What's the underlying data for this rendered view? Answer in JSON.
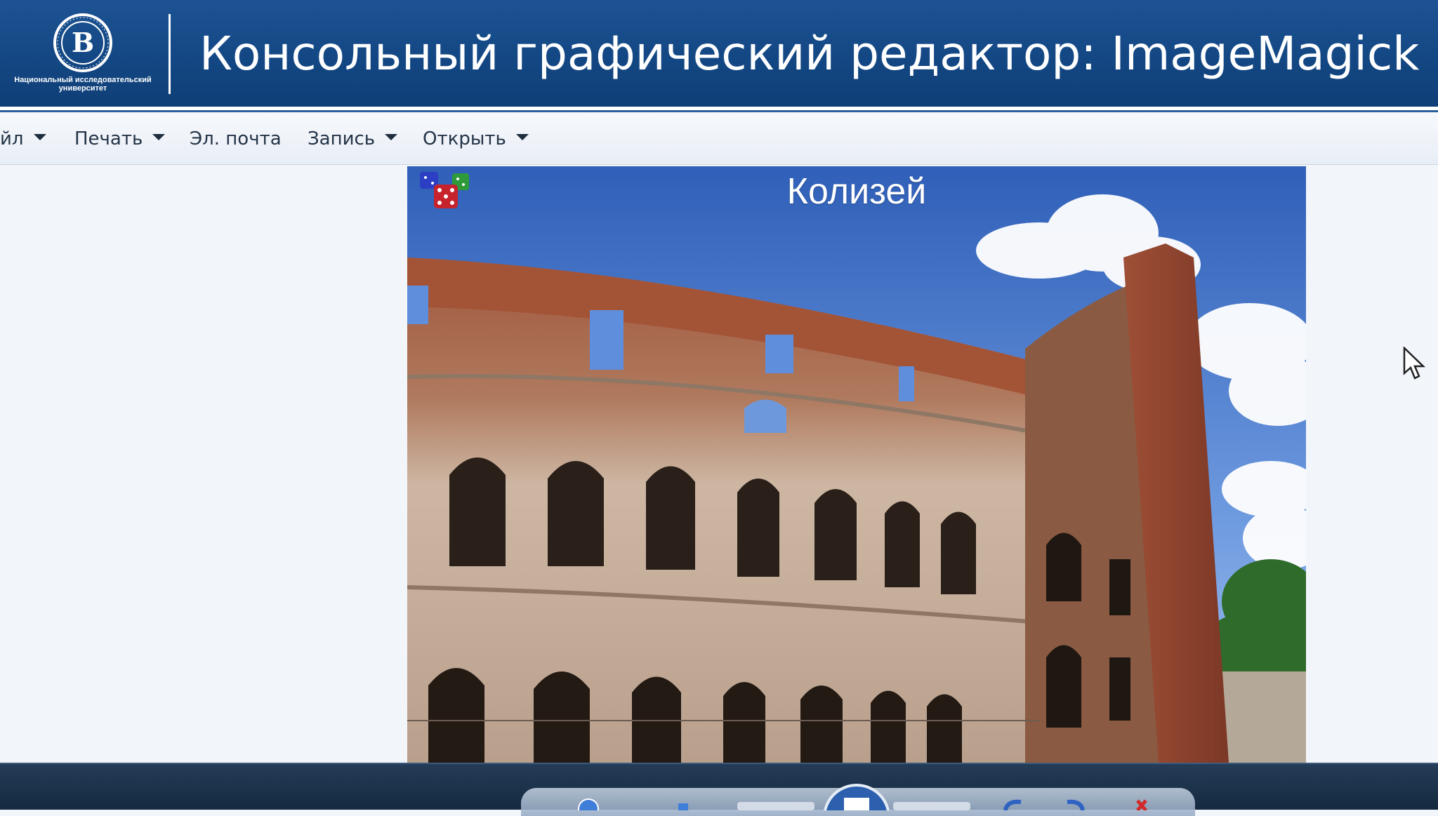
{
  "header": {
    "title": "Консольный графический редактор: ImageMagick",
    "logo_text_line1": "Национальный исследовательский",
    "logo_text_line2": "университет",
    "logo_letter": "В"
  },
  "toolbar": {
    "items": [
      {
        "label": "йл",
        "has_dropdown": true
      },
      {
        "label": "Печать",
        "has_dropdown": true
      },
      {
        "label": "Эл. почта",
        "has_dropdown": false
      },
      {
        "label": "Запись",
        "has_dropdown": true
      },
      {
        "label": "Открыть",
        "has_dropdown": true
      }
    ]
  },
  "viewer": {
    "image_caption": "Колизей",
    "icons": [
      "dice-icon",
      "mouse-cursor-icon"
    ]
  },
  "playback_controls": {
    "icons": [
      "help-icon",
      "info-icon",
      "previous-icon",
      "slideshow-icon",
      "next-icon",
      "rotate-left-icon",
      "rotate-right-icon",
      "delete-icon"
    ]
  },
  "colors": {
    "header_bg": "#134783",
    "toolbar_bg": "#eef2f8",
    "pane_bg": "#f2f6fb",
    "sky": "#3f6fc4"
  }
}
